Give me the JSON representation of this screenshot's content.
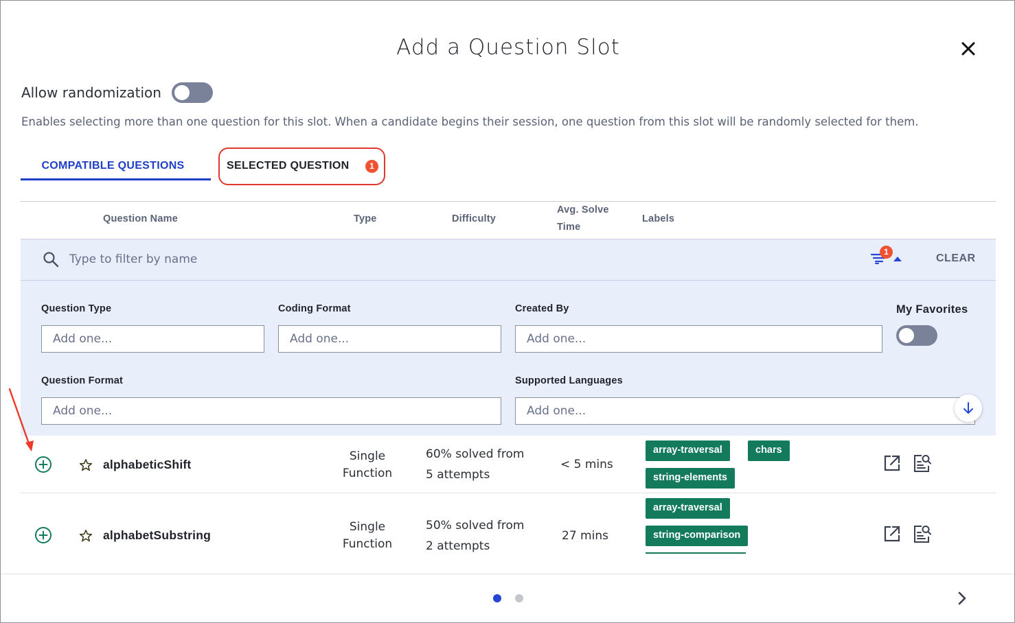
{
  "modal": {
    "title": "Add a Question Slot",
    "close_icon": "close-icon"
  },
  "randomization": {
    "label": "Allow randomization",
    "enabled": false,
    "description": "Enables selecting more than one question for this slot. When a candidate begins their session, one question from this slot will be randomly selected for them."
  },
  "tabs": {
    "compatible": {
      "label": "COMPATIBLE QUESTIONS",
      "active": true
    },
    "selected": {
      "label": "SELECTED QUESTION",
      "count": "1",
      "highlighted_color": "#e2372f"
    }
  },
  "table": {
    "headers": {
      "name": "Question Name",
      "type": "Type",
      "difficulty": "Difficulty",
      "avg_solve_line1": "Avg. Solve",
      "avg_solve_line2": "Time",
      "labels": "Labels"
    },
    "rows": [
      {
        "name": "alphabeticShift",
        "type_line1": "Single",
        "type_line2": "Function",
        "difficulty_line1": "60% solved from",
        "difficulty_line2": "5 attempts",
        "time": "< 5 mins",
        "tags": [
          "array-traversal",
          "chars",
          "string-elements"
        ]
      },
      {
        "name": "alphabetSubstring",
        "type_line1": "Single",
        "type_line2": "Function",
        "difficulty_line1": "50% solved from",
        "difficulty_line2": "2 attempts",
        "time": "27 mins",
        "tags": [
          "array-traversal",
          "string-comparison"
        ]
      }
    ]
  },
  "filters": {
    "search_placeholder": "Type to filter by name",
    "active_filter_count": "1",
    "clear_label": "CLEAR",
    "question_type": {
      "label": "Question Type",
      "placeholder": "Add one..."
    },
    "coding_format": {
      "label": "Coding Format",
      "placeholder": "Add one..."
    },
    "created_by": {
      "label": "Created By",
      "placeholder": "Add one..."
    },
    "my_favorites": {
      "label": "My Favorites",
      "enabled": false
    },
    "question_format": {
      "label": "Question Format",
      "placeholder": "Add one..."
    },
    "supported_languages": {
      "label": "Supported Languages",
      "placeholder": "Add one..."
    }
  },
  "pagination": {
    "pages": 2,
    "current": 1,
    "active_color": "#2546d6",
    "inactive_color": "#c3c6cc"
  },
  "colors": {
    "accent": "#1f3fc8",
    "tag_green": "#137a5c",
    "badge_orange": "#ef5232",
    "filter_bg": "#e9eefb"
  }
}
